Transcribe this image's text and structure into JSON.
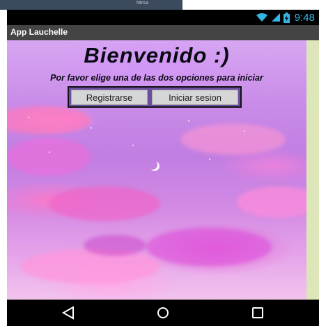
{
  "host": {
    "strip_text": "Ntrsa"
  },
  "status_bar": {
    "time": "9:48",
    "wifi_icon": "wifi-icon",
    "signal_icon": "signal-icon",
    "battery_icon": "battery-icon",
    "color": "#33b5e5"
  },
  "app": {
    "title": "App Lauchelle"
  },
  "content": {
    "welcome": "Bienvenido :)",
    "subtitle": "Por favor elige una de las dos opciones para iniciar",
    "register_label": "Registrarse",
    "login_label": "Iniciar sesion"
  },
  "nav": {
    "back_icon": "back-triangle-icon",
    "home_icon": "home-circle-icon",
    "recent_icon": "recent-apps-square-icon"
  },
  "colors": {
    "title_bar": "#444444",
    "side_strip": "#dde6b8",
    "button_group_border": "#111111"
  }
}
